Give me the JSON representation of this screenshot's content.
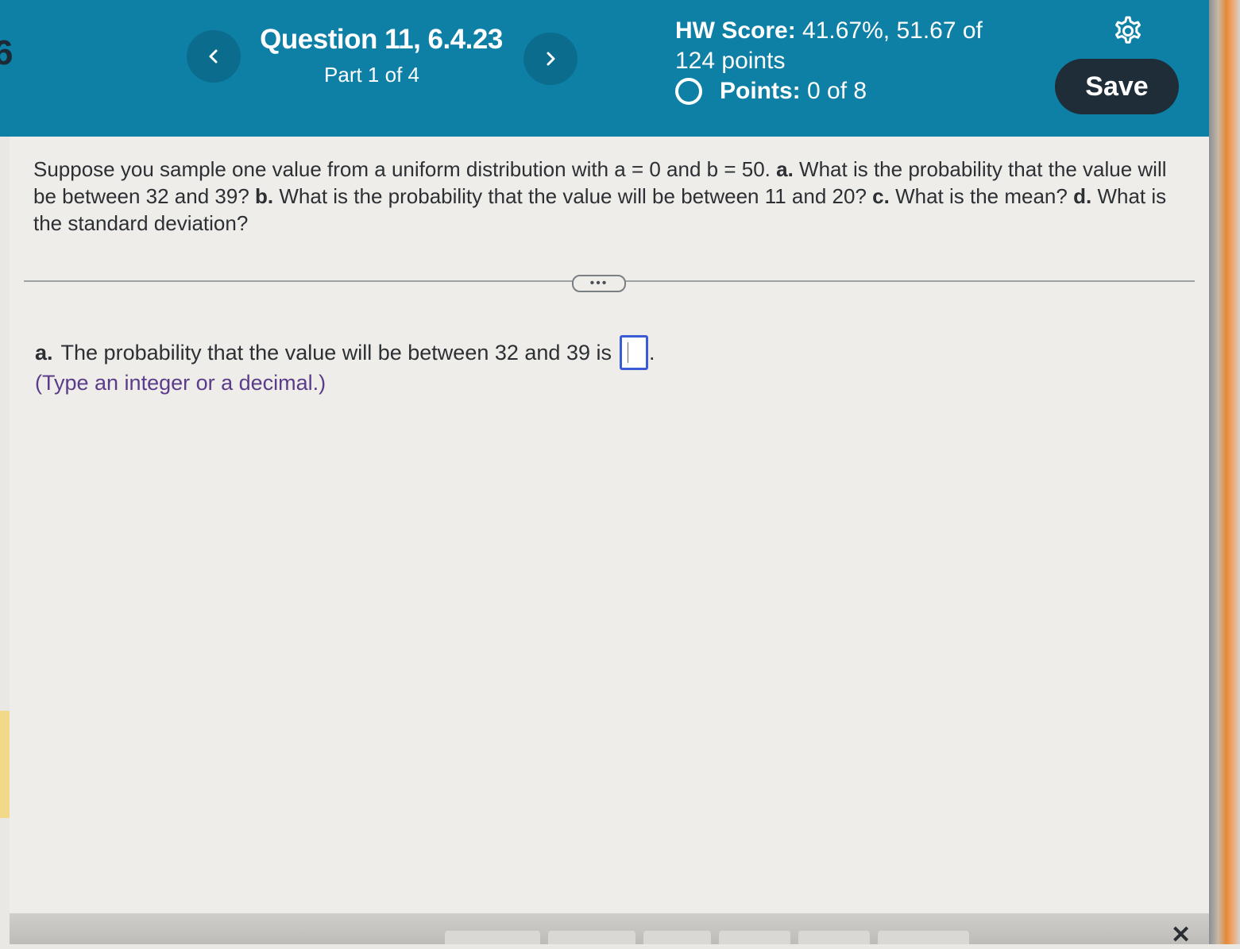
{
  "header": {
    "edge_digit": "6",
    "question_title": "Question 11, 6.4.23",
    "question_part": "Part 1 of 4",
    "hw_score_label": "HW Score:",
    "hw_score_value": "41.67%, 51.67 of 124 points",
    "points_label": "Points:",
    "points_value": "0 of 8",
    "save_label": "Save",
    "prev_icon": "chevron-left-icon",
    "next_icon": "chevron-right-icon",
    "settings_icon": "gear-icon"
  },
  "question": {
    "intro": "Suppose you sample one value from a uniform distribution with a = 0 and b = 50.",
    "a_label": "a.",
    "a_text": "What is the probability that the value will be between 32 and 39?",
    "b_label": "b.",
    "b_text": "What is the probability that the value will be between 11 and 20?",
    "c_label": "c.",
    "c_text": "What is the mean?",
    "d_label": "d.",
    "d_text": "What is the standard deviation?"
  },
  "expand_label": "•••",
  "answer": {
    "label": "a.",
    "text": "The probability that the value will be between 32 and 39 is",
    "value": "",
    "suffix": ".",
    "hint": "(Type an integer or a decimal.)"
  },
  "footer": {
    "close_label": "✕"
  },
  "colors": {
    "header_bg": "#0e7fa5",
    "save_bg": "#1e2d38",
    "answer_box_border": "#3b5bd6",
    "hint_color": "#5a3c8a"
  }
}
